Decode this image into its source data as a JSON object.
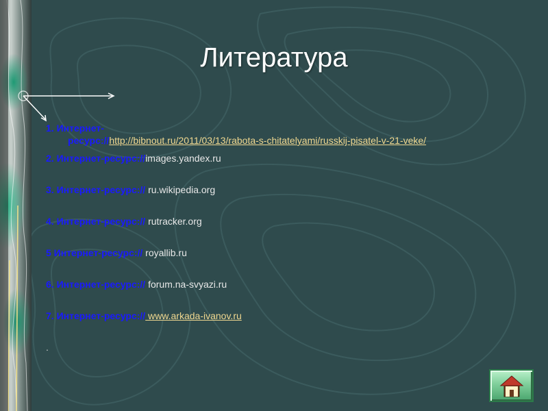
{
  "title": "Литература",
  "items": [
    {
      "label": "1. Интернет-ресурс://",
      "label_line1": "1. Интернет-",
      "label_line2": "ресурс://",
      "value": "http://bibnout.ru/2011/03/13/rabota-s-chitatelyami/russkij-pisatel-v-21-veke/",
      "is_link": true
    },
    {
      "label": "2. Интернет-ресурс://",
      "value": "images.yandex.ru",
      "is_link": false
    },
    {
      "label": "3. Интернет-ресурс://",
      "value": " ru.wikipedia.org",
      "is_link": false
    },
    {
      "label": "4. Интернет-ресурс://",
      "value": " rutracker.org",
      "is_link": false
    },
    {
      "label": "5 Интернет-ресурс://",
      "value": " royallib.ru",
      "is_link": false
    },
    {
      "label": "6. Интернет-ресурс://",
      "value": " forum.na-svyazi.ru",
      "is_link": false
    },
    {
      "label": "7. Интернет-ресурс://",
      "value": " www.arkada-ivanov.ru",
      "is_link": true
    }
  ],
  "trailing": ".",
  "home_icon": "home-icon",
  "colors": {
    "background": "#2f4b4d",
    "label": "#1a1aff",
    "link": "#f0d890",
    "title": "#ffffff"
  }
}
